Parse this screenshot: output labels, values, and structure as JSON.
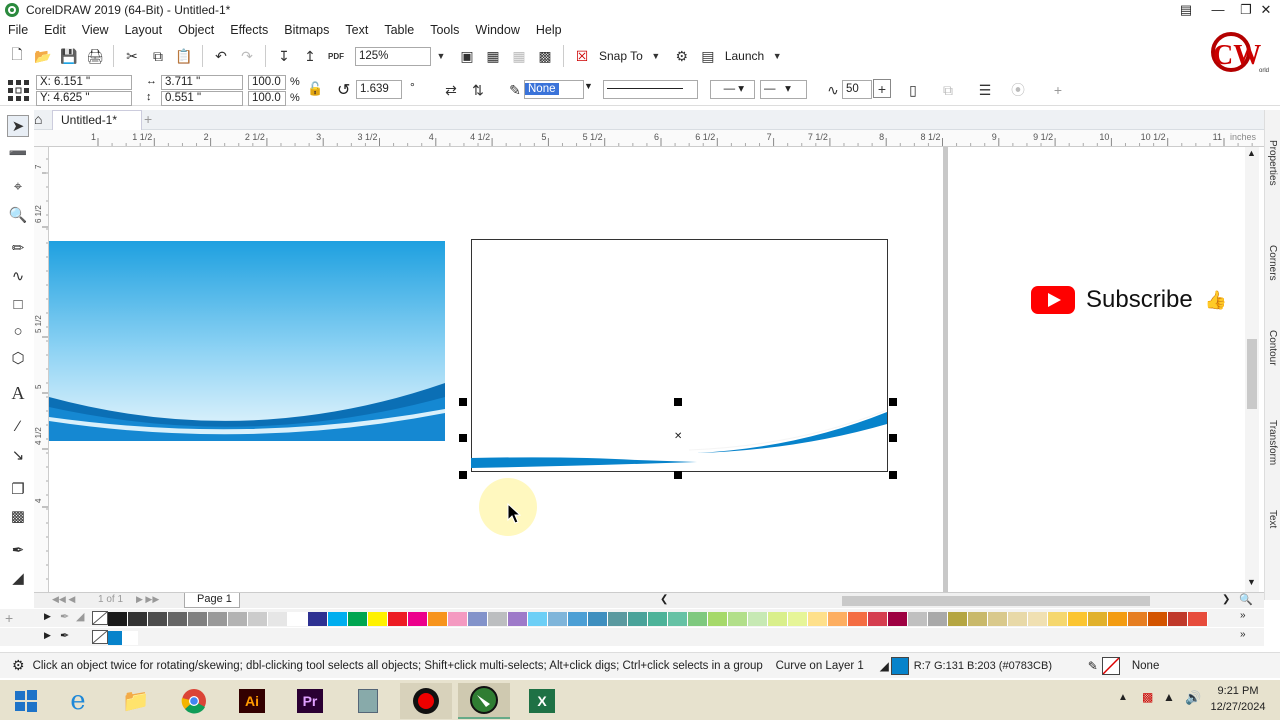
{
  "app": {
    "title": "CorelDRAW 2019 (64-Bit) - Untitled-1*"
  },
  "menu": [
    "File",
    "Edit",
    "View",
    "Layout",
    "Object",
    "Effects",
    "Bitmaps",
    "Text",
    "Table",
    "Tools",
    "Window",
    "Help"
  ],
  "standard_toolbar": {
    "zoom": "125%",
    "snap_to": "Snap To",
    "launch": "Launch",
    "pdf_label": "PDF"
  },
  "property_bar": {
    "x": "X: 6.151 \"",
    "y": "Y: 4.625 \"",
    "width": "3.711 \"",
    "height": "0.551 \"",
    "scale_w": "100.0",
    "scale_h": "100.0",
    "pct1": "%",
    "pct2": "%",
    "rotation": "1.639",
    "degree": "°",
    "fill_none": "None",
    "curve_smooth": "50"
  },
  "doc_tab": {
    "name": "Untitled-1*"
  },
  "rulers": {
    "h_labels": [
      "1",
      "1 1/2",
      "2",
      "2 1/2",
      "3",
      "3 1/2",
      "4",
      "4 1/2",
      "5",
      "5 1/2",
      "6",
      "6 1/2",
      "7",
      "7 1/2",
      "8",
      "8 1/2",
      "9",
      "9 1/2",
      "10",
      "10 1/2",
      "11"
    ],
    "h_unit": "inches",
    "v_labels": [
      "7",
      "6 1/2",
      "5 1/2",
      "5",
      "4 1/2",
      "4"
    ]
  },
  "page_nav": {
    "counter": "1 of 1",
    "page_tab": "Page 1"
  },
  "right_docker": {
    "tabs": [
      "Properties",
      "Corners",
      "Contour",
      "Transform",
      "Text"
    ]
  },
  "overlay": {
    "subscribe": "Subscribe",
    "logo_text": "CW",
    "logo_small": "orld"
  },
  "palette": {
    "row1": [
      "#1a1a1a",
      "#333333",
      "#4d4d4d",
      "#666666",
      "#808080",
      "#999999",
      "#b3b3b3",
      "#cccccc",
      "#e6e6e6",
      "#ffffff",
      "#2e3192",
      "#00aeef",
      "#00a651",
      "#fff200",
      "#ed1c24",
      "#ec008c",
      "#f7941d",
      "#f49ac1",
      "#8393ca",
      "#bcbec0",
      "#9e7ac9",
      "#6dcff6",
      "#7fb5da",
      "#4c9fd5",
      "#3f8fbf",
      "#5b9aa0",
      "#4aa39a",
      "#4db399",
      "#66c2a5",
      "#7fc97f",
      "#a6d96a",
      "#b2df8a",
      "#c7e9b4",
      "#d9ef8b",
      "#e6f598",
      "#fee08b",
      "#fdae61",
      "#f46d43",
      "#d53e4f",
      "#9e0142",
      "#c0c0c0",
      "#a9a9a9",
      "#b5a642",
      "#c9b96b",
      "#d9c98c",
      "#e8d9a8",
      "#f0e0b2",
      "#f5d76e",
      "#fbc531",
      "#e1b12c",
      "#f39c12",
      "#e67e22",
      "#d35400",
      "#c0392b",
      "#e74c3c"
    ],
    "row2": [
      "#0783cb",
      "#ffffff"
    ]
  },
  "status": {
    "hint": "Click an object twice for rotating/skewing; dbl-clicking tool selects all objects; Shift+click multi-selects; Alt+click digs; Ctrl+click selects in a group",
    "object": "Curve on Layer 1",
    "fill_color": "#0783CB",
    "fill_text": "R:7 G:131 B:203 (#0783CB)",
    "outline_text": "None"
  },
  "taskbar": {
    "time": "9:21 PM",
    "date": "12/27/2024",
    "apps": [
      "start",
      "ie",
      "explorer",
      "chrome",
      "illustrator",
      "premiere",
      "calculator",
      "recorder",
      "coreldraw",
      "excel"
    ],
    "ai_label": "Ai",
    "pr_label": "Pr"
  },
  "colors": {
    "accent": "#0783CB",
    "ribbon_blue": "#1e90d8",
    "brand_red": "#ff0000"
  }
}
